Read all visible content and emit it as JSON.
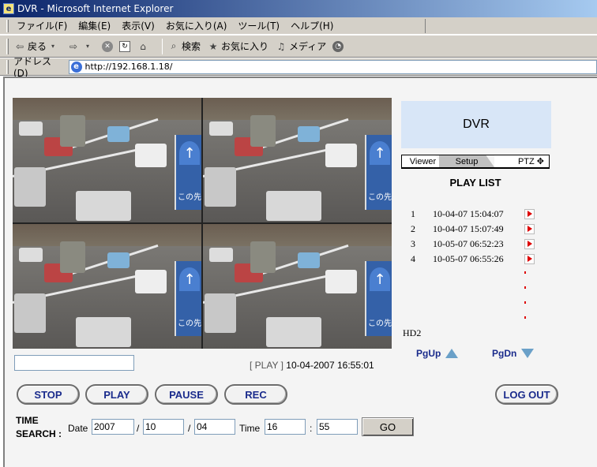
{
  "window": {
    "title": "DVR - Microsoft Internet Explorer"
  },
  "menu": [
    "ファイル(F)",
    "編集(E)",
    "表示(V)",
    "お気に入り(A)",
    "ツール(T)",
    "ヘルプ(H)"
  ],
  "toolbar": {
    "back": "戻る",
    "search": "検索",
    "favorites": "お気に入り",
    "media": "メディア"
  },
  "address": {
    "label": "アドレス(D)",
    "url": "http://192.168.1.18/"
  },
  "dvr": {
    "title": "DVR",
    "tabs": {
      "viewer": "Viewer",
      "setup": "Setup",
      "ptz": "PTZ ✥"
    },
    "playlist_title": "PLAY LIST",
    "playlist": [
      {
        "num": "1",
        "time": "10-04-07 15:04:07"
      },
      {
        "num": "2",
        "time": "10-04-07 15:07:49"
      },
      {
        "num": "3",
        "time": "10-05-07 06:52:23"
      },
      {
        "num": "4",
        "time": "10-05-07 06:55:26"
      }
    ],
    "disk_label": "HD2",
    "page_up": "PgUp",
    "page_down": "PgDn",
    "camera_overlay_text": "この先"
  },
  "status": {
    "state": "[ PLAY ]",
    "datetime": "10-04-2007 16:55:01"
  },
  "buttons": {
    "stop": "STOP",
    "play": "PLAY",
    "pause": "PAUSE",
    "rec": "REC",
    "logout": "LOG OUT"
  },
  "time_search": {
    "label_line1": "TIME",
    "label_line2": "SEARCH :",
    "date_label": "Date",
    "year": "2007",
    "month": "10",
    "day": "04",
    "time_label": "Time",
    "hour": "16",
    "minute": "55",
    "sep_slash": "/",
    "sep_colon": ":",
    "go": "GO"
  }
}
